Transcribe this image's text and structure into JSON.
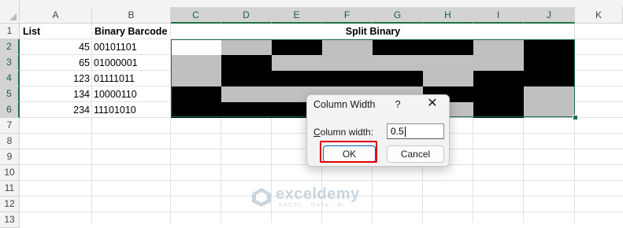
{
  "columns": [
    "A",
    "B",
    "C",
    "D",
    "E",
    "F",
    "G",
    "H",
    "I",
    "J",
    "K"
  ],
  "rows": [
    "1",
    "2",
    "3",
    "4",
    "5",
    "6",
    "7",
    "8",
    "9",
    "10",
    "11",
    "12",
    "13"
  ],
  "headers": {
    "list": "List",
    "barcode": "Binary Barcode",
    "split": "Split Binary"
  },
  "data_rows": [
    {
      "list": "45",
      "barcode": "00101101"
    },
    {
      "list": "65",
      "barcode": "01000001"
    },
    {
      "list": "123",
      "barcode": "01111011"
    },
    {
      "list": "134",
      "barcode": "10000110"
    },
    {
      "list": "234",
      "barcode": "11101010"
    }
  ],
  "colors": {
    "black": "#000000",
    "gray": "#c0c0c0",
    "white": "#ffffff",
    "selection": "#1e7145",
    "highlight": "#e00000"
  },
  "dialog": {
    "title": "Column Width",
    "help_glyph": "?",
    "close_glyph": "✕",
    "label": "Column width:",
    "value": "0.5",
    "ok_label": "OK",
    "cancel_label": "Cancel"
  },
  "watermark": {
    "name": "exceldemy",
    "tagline": "EXCEL · DATA · BI",
    "icon": "exceldemy-logo-icon"
  }
}
